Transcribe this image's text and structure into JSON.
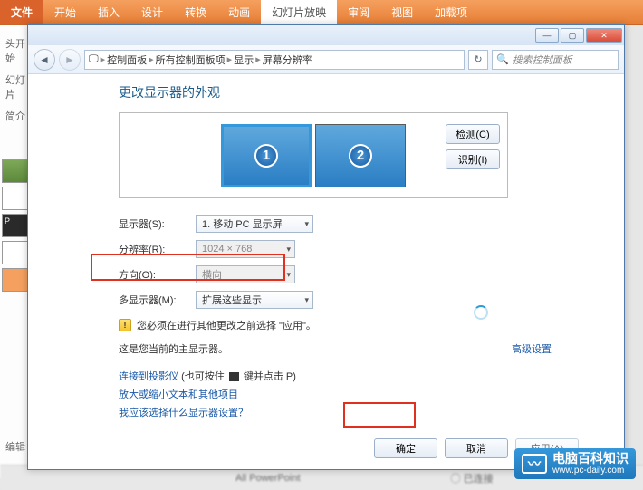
{
  "ppt": {
    "tabs": {
      "file": "文件",
      "start": "开始",
      "insert": "插入",
      "design": "设计",
      "transition": "转换",
      "anim": "动画",
      "slideshow": "幻灯片放映",
      "review": "审阅",
      "view": "视图",
      "addin": "加载项"
    },
    "side": {
      "status": "头开始",
      "tab1": "幻灯片",
      "tab2": "简介"
    },
    "editbar": "编辑",
    "bottom_label": "All PowerPoint",
    "bottom_status": "已连接"
  },
  "breadcrumb": {
    "c1": "控制面板",
    "c2": "所有控制面板项",
    "c3": "显示",
    "c4": "屏幕分辨率"
  },
  "search_placeholder": "搜索控制面板",
  "heading": "更改显示器的外观",
  "monitors": {
    "n1": "1",
    "n2": "2"
  },
  "buttons": {
    "detect": "检测(C)",
    "identify": "识别(I)",
    "ok": "确定",
    "cancel": "取消",
    "apply": "应用(A)"
  },
  "labels": {
    "display": "显示器(S):",
    "resolution": "分辨率(R):",
    "orientation": "方向(O):",
    "multi": "多显示器(M):"
  },
  "values": {
    "display": "1. 移动 PC 显示屏",
    "resolution": "1024 × 768",
    "orientation": "横向",
    "multi": "扩展这些显示"
  },
  "warning": "您必须在进行其他更改之前选择 \"应用\"。",
  "primary_note": "这是您当前的主显示器。",
  "advanced": "高级设置",
  "links": {
    "projector_a": "连接到投影仪",
    "projector_b": "(也可按住",
    "projector_c": "键并点击 P)",
    "textsize": "放大或缩小文本和其他项目",
    "whichdisplay": "我应该选择什么显示器设置？"
  },
  "watermark": {
    "title": "电脑百科知识",
    "url": "www.pc-daily.com"
  }
}
